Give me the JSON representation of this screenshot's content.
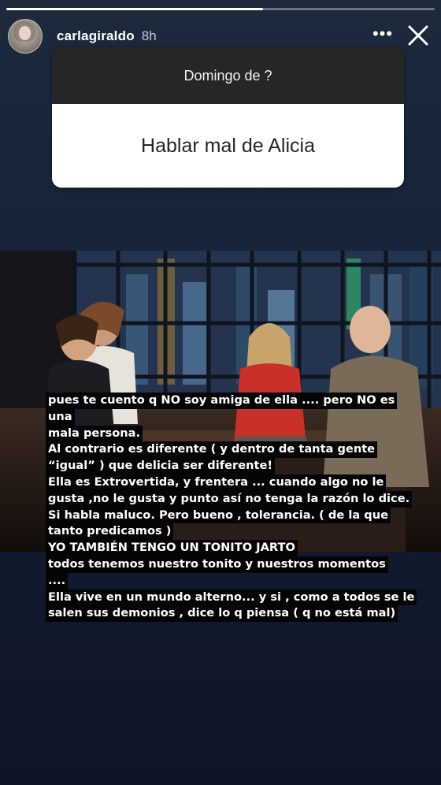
{
  "story": {
    "progress_fraction": 0.6,
    "username": "carlagiraldo",
    "time": "8h",
    "more_label": "•••",
    "close_icon": "close-icon",
    "more_icon": "more-options-icon"
  },
  "question_sticker": {
    "question": "Domingo de ?",
    "answer": "Hablar mal de Alicia"
  },
  "caption_lines": [
    "pues te cuento q NO  soy amiga de ella .... pero NO es",
    "una",
    "mala persona.",
    "Al contrario es diferente ( y dentro de tanta gente",
    "“igual” ) que delicia ser diferente!",
    "Ella es Extrovertida, y frentera ... cuando algo no le",
    "gusta ,no le gusta y punto así no tenga la razón lo dice.",
    "Si habla maluco. Pero bueno , tolerancia. ( de la que",
    "tanto predicamos )",
    "YO TAMBIÉN TENGO UN TONITO JARTO",
    "todos tenemos nuestro tonito y nuestros momentos",
    "....",
    "Ella vive en un mundo alterno... y si , como a todos se le",
    "salen sus demonios , dice lo q piensa ( q no está mal)"
  ],
  "colors": {
    "background_top": "#1c2a3c",
    "background_bottom": "#0e1526",
    "sticker_header": "#262626",
    "sticker_body": "#ffffff",
    "caption_bg": "#050505",
    "presenter_dress": "#c8302a"
  }
}
